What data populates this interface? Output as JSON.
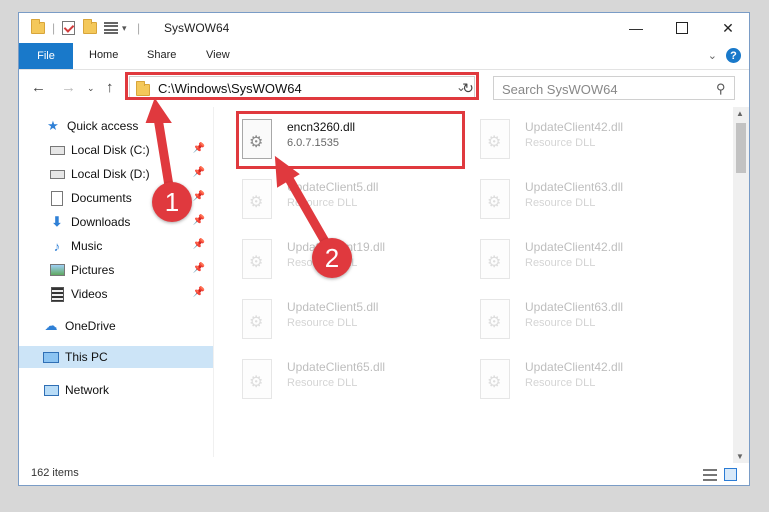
{
  "window": {
    "title": "SysWOW64"
  },
  "ribbon": {
    "file_tab": "File",
    "tabs": [
      "Home",
      "Share",
      "View"
    ],
    "help": "?"
  },
  "address": {
    "path": "C:\\Windows\\SysWOW64"
  },
  "search": {
    "placeholder": "Search SysWOW64"
  },
  "sidebar": {
    "items": [
      {
        "label": "Quick access",
        "icon": "star-icon"
      },
      {
        "label": "Local Disk (C:)",
        "icon": "drive-icon"
      },
      {
        "label": "Local Disk (D:)",
        "icon": "drive-icon"
      },
      {
        "label": "Documents",
        "icon": "documents-icon"
      },
      {
        "label": "Downloads",
        "icon": "download-icon"
      },
      {
        "label": "Music",
        "icon": "music-icon"
      },
      {
        "label": "Pictures",
        "icon": "pictures-icon"
      },
      {
        "label": "Videos",
        "icon": "videos-icon"
      },
      {
        "label": "OneDrive",
        "icon": "cloud-icon"
      },
      {
        "label": "This PC",
        "icon": "computer-icon"
      },
      {
        "label": "Network",
        "icon": "network-icon"
      }
    ]
  },
  "files": [
    {
      "name": "encn3260.dll",
      "sub": "6.0.7.1535"
    },
    {
      "name": "UpdateClient42.dll",
      "sub": "Resource DLL"
    },
    {
      "name": "UpdateClient5.dll",
      "sub": "Resource DLL"
    },
    {
      "name": "UpdateClient63.dll",
      "sub": "Resource DLL"
    },
    {
      "name": "UpdateClient19.dll",
      "sub": "Resource DLL"
    },
    {
      "name": "UpdateClient42.dll",
      "sub": "Resource DLL"
    },
    {
      "name": "UpdateClient5.dll",
      "sub": "Resource DLL"
    },
    {
      "name": "UpdateClient63.dll",
      "sub": "Resource DLL"
    },
    {
      "name": "UpdateClient65.dll",
      "sub": "Resource DLL"
    },
    {
      "name": "UpdateClient42.dll",
      "sub": "Resource DLL"
    }
  ],
  "status": {
    "count": "162 items"
  },
  "annotations": {
    "step1": "1",
    "step2": "2",
    "color": "#e0393e"
  }
}
